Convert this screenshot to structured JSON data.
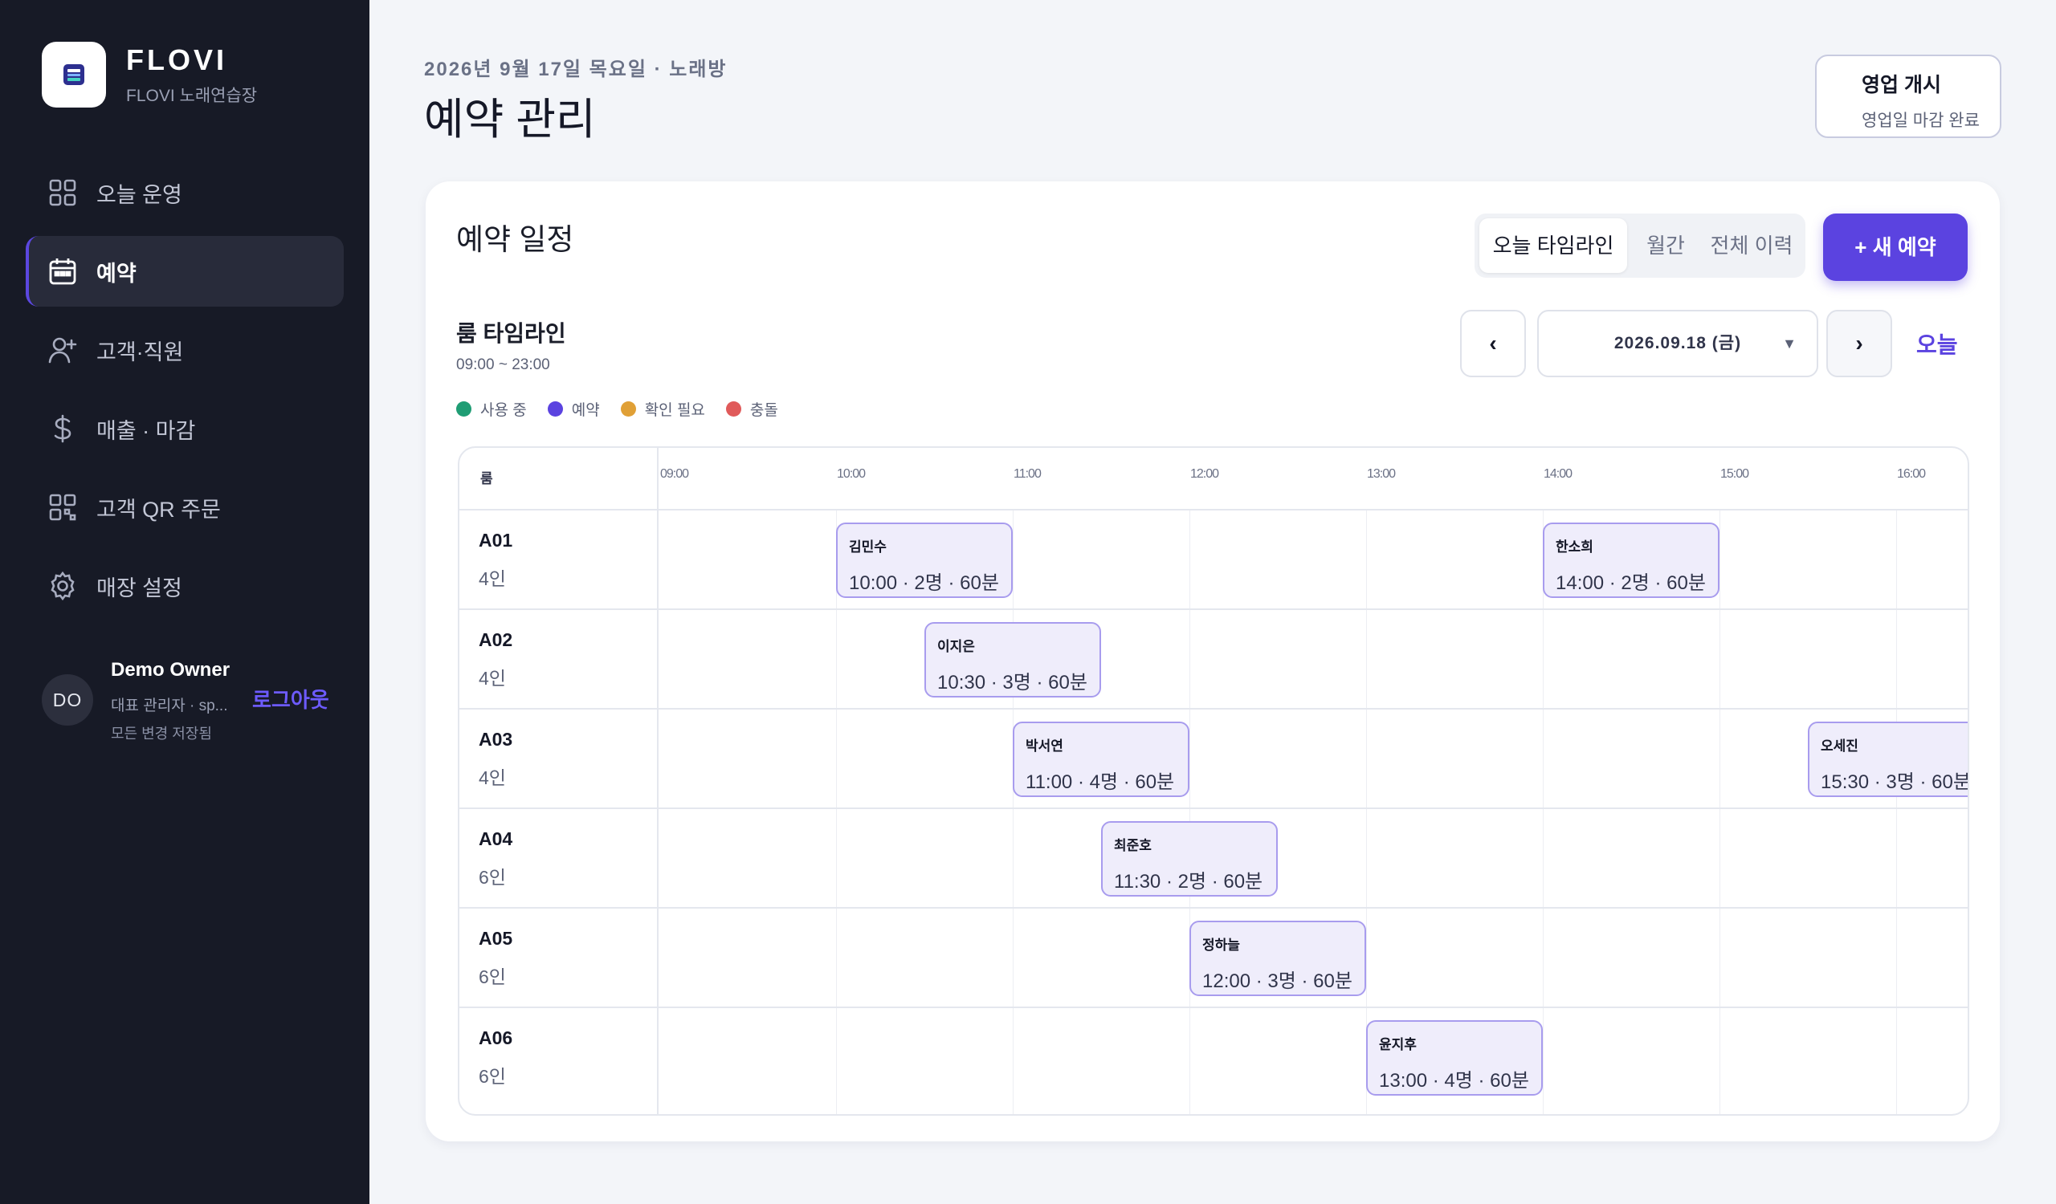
{
  "brand": {
    "name": "FLOVI",
    "sub": "FLOVI 노래연습장"
  },
  "nav": [
    {
      "label": "오늘 운영",
      "icon": "grid-icon"
    },
    {
      "label": "예약",
      "icon": "calendar-icon"
    },
    {
      "label": "고객·직원",
      "icon": "user-plus-icon"
    },
    {
      "label": "매출 · 마감",
      "icon": "dollar-icon"
    },
    {
      "label": "고객 QR 주문",
      "icon": "qr-icon"
    },
    {
      "label": "매장 설정",
      "icon": "gear-icon"
    }
  ],
  "user": {
    "initials": "DO",
    "name": "Demo Owner",
    "role": "대표 관리자 · sp...",
    "save_status": "모든 변경 저장됨",
    "logout": "로그아웃"
  },
  "header": {
    "crumb": "2026년 9월 17일 목요일 · 노래방",
    "title": "예약 관리"
  },
  "open_button": {
    "title": "영업 개시",
    "sub": "영업일 마감 완료"
  },
  "card": {
    "title": "예약 일정",
    "tabs": [
      "오늘 타임라인",
      "월간",
      "전체 이력"
    ],
    "new_button": "+ 새 예약"
  },
  "timeline": {
    "title": "룸 타임라인",
    "range": "09:00 ~ 23:00",
    "prev": "‹",
    "next": "›",
    "date": "2026.09.18 (금)",
    "today": "오늘",
    "legend": [
      {
        "label": "사용 중",
        "color": "#1f9d74"
      },
      {
        "label": "예약",
        "color": "#5b43e0"
      },
      {
        "label": "확인 필요",
        "color": "#e0a036"
      },
      {
        "label": "충돌",
        "color": "#e05a5a"
      }
    ],
    "room_header": "룸",
    "times": [
      "09:00",
      "10:00",
      "11:00",
      "12:00",
      "13:00",
      "14:00",
      "15:00",
      "16:00"
    ],
    "rows": [
      {
        "room": "A01",
        "cap": "4인"
      },
      {
        "room": "A02",
        "cap": "4인"
      },
      {
        "room": "A03",
        "cap": "4인"
      },
      {
        "room": "A04",
        "cap": "6인"
      },
      {
        "room": "A05",
        "cap": "6인"
      },
      {
        "room": "A06",
        "cap": "6인"
      }
    ],
    "bookings": [
      {
        "name": "김민수",
        "info": "10:00 · 2명 · 60분"
      },
      {
        "name": "한소희",
        "info": "14:00 · 2명 · 60분"
      },
      {
        "name": "이지은",
        "info": "10:30 · 3명 · 60분"
      },
      {
        "name": "박서연",
        "info": "11:00 · 4명 · 60분"
      },
      {
        "name": "오세진",
        "info": "15:30 · 3명 · 60분"
      },
      {
        "name": "최준호",
        "info": "11:30 · 2명 · 60분"
      },
      {
        "name": "정하늘",
        "info": "12:00 · 3명 · 60분"
      },
      {
        "name": "윤지후",
        "info": "13:00 · 4명 · 60분"
      }
    ]
  }
}
